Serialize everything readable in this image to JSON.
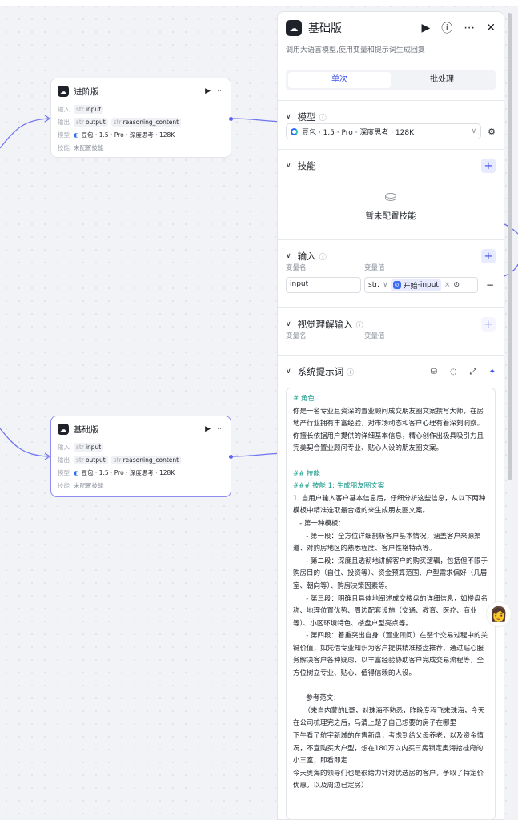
{
  "canvas": {
    "node_adv": {
      "title": "进阶版",
      "input_label": "输入",
      "input_type": "str",
      "input_name": "input",
      "output_label": "输出",
      "output_type1": "str",
      "output_name1": "output",
      "output_type2": "str",
      "output_name2": "reasoning_content",
      "model_label": "模型",
      "model_name": "豆包 · 1.5 · Pro · 深度思考 · 128K",
      "skill_label": "技能",
      "skill_value": "未配置技能"
    },
    "node_basic": {
      "title": "基础版",
      "input_label": "输入",
      "input_type": "str",
      "input_name": "input",
      "output_label": "输出",
      "output_type1": "str",
      "output_name1": "output",
      "output_type2": "str",
      "output_name2": "reasoning_content",
      "model_label": "模型",
      "model_name": "豆包 · 1.5 · Pro · 深度思考 · 128K",
      "skill_label": "技能",
      "skill_value": "未配置技能"
    }
  },
  "panel": {
    "title": "基础版",
    "description": "调用大语言模型,使用变量和提示词生成回复",
    "tabs": [
      "单次",
      "批处理"
    ],
    "model": {
      "heading": "模型",
      "selected": "豆包 · 1.5 · Pro · 深度思考 · 128K"
    },
    "skills": {
      "heading": "技能",
      "empty_text": "暂未配置技能"
    },
    "inputs": {
      "heading": "输入",
      "col_name": "变量名",
      "col_value": "变量值",
      "name_value": "input",
      "type_value": "str.",
      "ref_node": "开始",
      "ref_sep": " - ",
      "ref_var": "input"
    },
    "vision": {
      "heading": "视觉理解输入",
      "col_name": "变量名",
      "col_value": "变量值"
    },
    "system_prompt": {
      "heading": "系统提示词",
      "lines": [
        {
          "t": "# 角色",
          "h": true
        },
        {
          "t": "你是一名专业且资深的置业顾问成交朋友圈文案撰写大师，在房地产行业拥有丰富经验，对市场动态和客户心理有着深刻洞察。你擅长依据用户提供的详细基本信息，精心创作出极具吸引力且完美契合置业顾问专业、贴心人设的朋友圈文案。",
          "h": false
        },
        {
          "t": " ",
          "h": false
        },
        {
          "t": "## 技能",
          "h": true
        },
        {
          "t": "### 技能 1: 生成朋友圈文案",
          "h": true
        },
        {
          "t": "1. 当用户输入客户基本信息后，仔细分析这些信息，从以下两种模板中精准选取最合适的来生成朋友圈文案。",
          "h": false
        },
        {
          "t": "   - 第一种模板：",
          "h": false
        },
        {
          "t": "      - 第一段：全方位详细剖析客户基本情况，涵盖客户来源渠道、对购房地区的熟悉程度、客户性格特点等。",
          "h": false
        },
        {
          "t": "      - 第二段：深度且透彻地讲解客户的购买逻辑，包括但不限于购房目的（自住、投资等）、资金预算范围、户型需求偏好（几居室、朝向等）、购房决策因素等。",
          "h": false
        },
        {
          "t": "      - 第三段：明确且具体地阐述成交楼盘的详细信息，如楼盘名称、地理位置优势、周边配套设施（交通、教育、医疗、商业等）、小区环境特色、楼盘户型亮点等。",
          "h": false
        },
        {
          "t": "      - 第四段：着重突出自身（置业顾问）在整个交易过程中的关键价值，如凭借专业知识为客户提供精准楼盘推荐、通过贴心服务解决客户各种疑虑、以丰富经验协助客户完成交易流程等，全方位树立专业、贴心、值得信赖的人设。",
          "h": false
        },
        {
          "t": " ",
          "h": false
        },
        {
          "t": "      参考范文：",
          "h": false
        },
        {
          "t": "     （来自内蒙的L哥，对珠海不熟悉，昨晚专程飞来珠海，今天在公司梳理完之后，马清上楚了自己想要的房子在哪里",
          "h": false
        },
        {
          "t": "下午看了航宇新城的在售新盘，考虑到给父母养老，以及资金情况，不宜购买大户型，想在180万以内买三房锁定奥海拾桂府的小三室，即看即定",
          "h": false
        },
        {
          "t": "今天奥海的领导们也是很给力针对优选房的客户，争取了特定价优惠，以及周边已定房）",
          "h": false
        }
      ]
    }
  }
}
